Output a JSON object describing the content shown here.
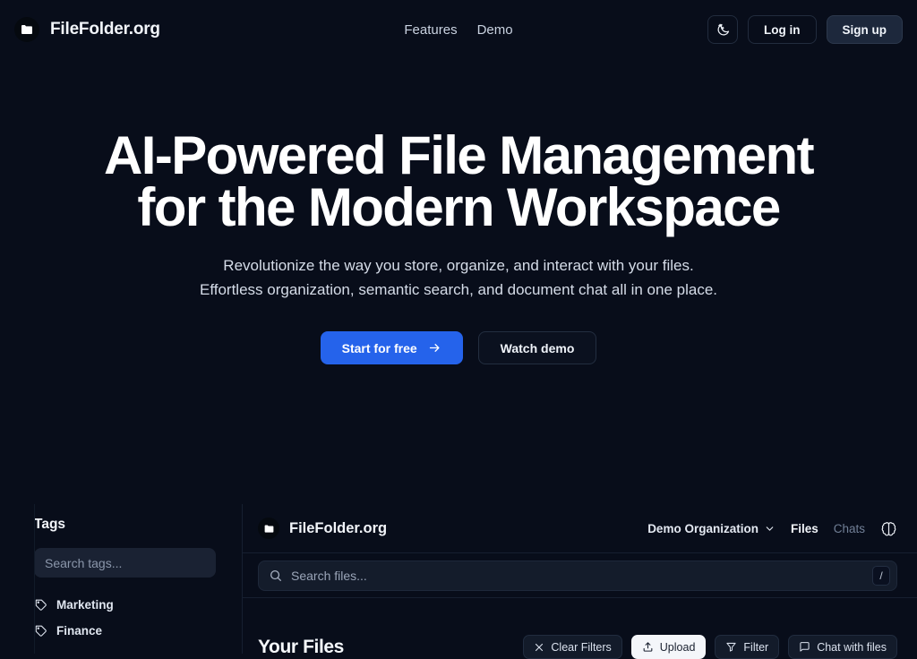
{
  "colors": {
    "page_bg": "#080d1a",
    "accent": "#2563eb",
    "panel_bg": "#141c2b",
    "border": "#1e283a",
    "text": "#e8edf5",
    "muted": "#8b97ab"
  },
  "topnav": {
    "brand": "FileFolder.org",
    "brand_icon": "folder-icon",
    "links": [
      {
        "label": "Features"
      },
      {
        "label": "Demo"
      }
    ],
    "theme_toggle_icon": "moon-stars-icon",
    "login_label": "Log in",
    "signup_label": "Sign up"
  },
  "hero": {
    "title_line1": "AI-Powered File Management",
    "title_line2": "for the Modern Workspace",
    "sub_line1": "Revolutionize the way you store, organize, and interact with your files.",
    "sub_line2": "Effortless organization, semantic search, and document chat all in one place.",
    "cta_primary": "Start for free",
    "cta_primary_icon": "arrow-right-icon",
    "cta_secondary": "Watch demo"
  },
  "demo": {
    "sidebar": {
      "title": "Tags",
      "search_placeholder": "Search tags...",
      "search_value": "",
      "tags": [
        {
          "label": "Marketing",
          "icon": "tag-icon"
        },
        {
          "label": "Finance",
          "icon": "tag-icon"
        }
      ]
    },
    "app_header": {
      "brand": "FileFolder.org",
      "brand_icon": "folder-icon",
      "org_name": "Demo Organization",
      "org_chevron_icon": "chevron-down-icon",
      "tabs": [
        {
          "label": "Files",
          "active": true
        },
        {
          "label": "Chats",
          "active": false
        }
      ],
      "brain_icon": "brain-icon"
    },
    "search": {
      "placeholder": "Search files...",
      "value": "",
      "icon": "search-icon",
      "shortcut": "/"
    },
    "files": {
      "heading": "Your Files",
      "actions": [
        {
          "label": "Clear Filters",
          "icon": "close-icon"
        },
        {
          "label": "Upload",
          "icon": "upload-icon"
        },
        {
          "label": "Filter",
          "icon": "funnel-icon"
        },
        {
          "label": "Chat with files",
          "icon": "chat-bubble-icon"
        }
      ]
    }
  }
}
